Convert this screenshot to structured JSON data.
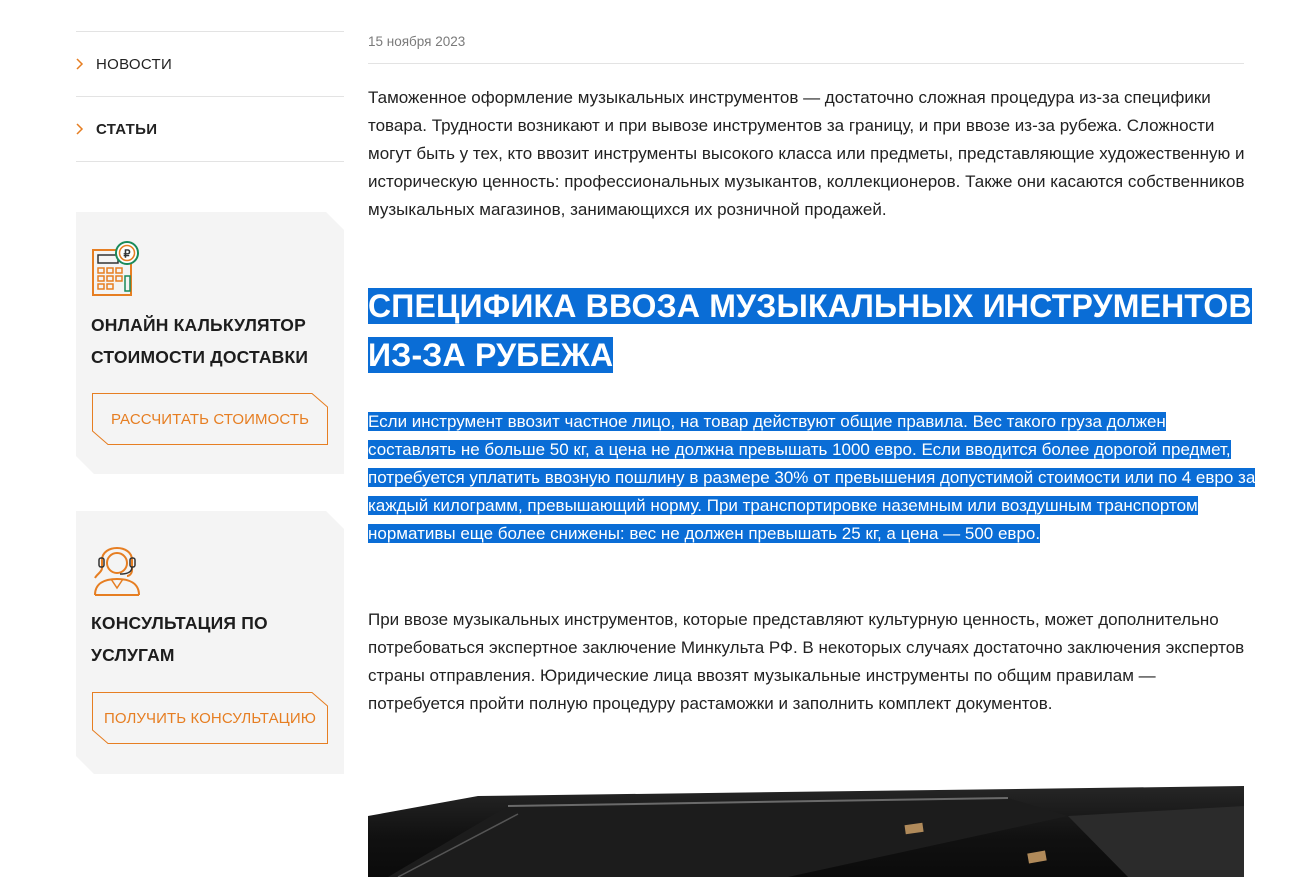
{
  "sidebar": {
    "nav": [
      {
        "label": "НОВОСТИ"
      },
      {
        "label": "СТАТЬИ"
      }
    ],
    "cards": [
      {
        "icon": "calculator-ruble-icon",
        "title": "ОНЛАЙН КАЛЬКУЛЯТОР СТОИМОСТИ ДОСТАВКИ",
        "button": "РАССЧИТАТЬ СТОИМОСТЬ"
      },
      {
        "icon": "support-operator-icon",
        "title": "КОНСУЛЬТАЦИЯ ПО УСЛУГАМ",
        "button": "ПОЛУЧИТЬ КОНСУЛЬТАЦИЮ"
      }
    ]
  },
  "article": {
    "date": "15 ноября 2023",
    "intro": "Таможенное оформление музыкальных инструментов — достаточно сложная процедура из-за специфики товара. Трудности возникают и при вывозе инструментов за границу, и при ввозе из-за рубежа. Сложности могут быть у тех, кто ввозит инструменты высокого класса или предметы, представляющие художественную и историческую ценность: профессиональных музыкантов, коллекционеров. Также они касаются собственников музыкальных магазинов, занимающихся их розничной продажей.",
    "heading": "СПЕЦИФИКА ВВОЗА МУЗЫКАЛЬНЫХ ИНСТРУМЕНТОВ ИЗ-ЗА РУБЕЖА",
    "selected_paragraph": "Если инструмент ввозит частное лицо, на товар действуют общие правила. Вес такого груза должен составлять не больше 50 кг, а цена не должна превышать 1000 евро. Если вводится более дорогой предмет, потребуется уплатить ввозную пошлину в размере 30% от превышения допустимой стоимости или по 4 евро за каждый килограмм, превышающий норму. При транспортировке наземным или воздушным транспортом нормативы еще более снижены: вес не должен превышать 25 кг, а цена — 500 евро.",
    "paragraph_3": "При ввозе музыкальных инструментов, которые представляют культурную ценность, может дополнительно потребоваться экспертное заключение Минкульта РФ. В некоторых случаях достаточно заключения экспертов страны отправления. Юридические лица ввозят музыкальные инструменты по общим правилам — потребуется пройти полную процедуру растаможки и заполнить комплект документов.",
    "image": "piano-photo"
  },
  "colors": {
    "accent": "#e67e22",
    "selection": "#0a6dd6",
    "card_bg": "#f4f4f4"
  }
}
